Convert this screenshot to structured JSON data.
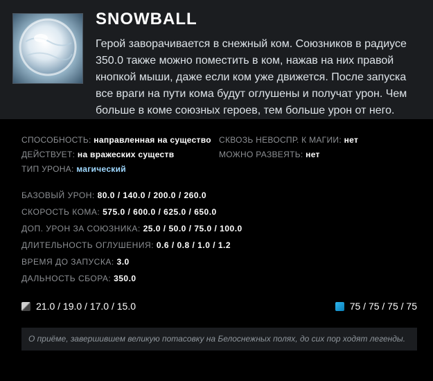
{
  "ability": {
    "icon": "snowball-icon",
    "name": "SNOWBALL",
    "description": "Герой заворачивается в снежный ком. Союзников в радиусе 350.0 также можно поместить в ком, нажав на них правой кнопкой мыши, даже если ком уже движется. После запуска все враги на пути кома будут оглушены и получат урон. Чем больше в коме союзных героев, тем больше урон от него."
  },
  "properties": {
    "ability_label": "СПОСОБНОСТЬ:",
    "ability_value": "направленная на существо",
    "pierce_label": "СКВОЗЬ НЕВОСПР. К МАГИИ:",
    "pierce_value": "нет",
    "affects_label": "ДЕЙСТВУЕТ:",
    "affects_value": "на вражеских существ",
    "dispel_label": "МОЖНО РАЗВЕЯТЬ:",
    "dispel_value": "нет",
    "damage_type_label": "ТИП УРОНА:",
    "damage_type_value": "магический"
  },
  "stats": [
    {
      "label": "БАЗОВЫЙ УРОН:",
      "value": "80.0 / 140.0 / 200.0 / 260.0"
    },
    {
      "label": "СКОРОСТЬ КОМА:",
      "value": "575.0 / 600.0 / 625.0 / 650.0"
    },
    {
      "label": "ДОП. УРОН ЗА СОЮЗНИКА:",
      "value": "25.0 / 50.0 / 75.0 / 100.0"
    },
    {
      "label": "ДЛИТЕЛЬНОСТЬ ОГЛУШЕНИЯ:",
      "value": "0.6 / 0.8 / 1.0 / 1.2"
    },
    {
      "label": "ВРЕМЯ ДО ЗАПУСКА:",
      "value": "3.0"
    },
    {
      "label": "ДАЛЬНОСТЬ СБОРА:",
      "value": "350.0"
    }
  ],
  "cooldown": {
    "icon": "cooldown-icon",
    "value": "21.0 / 19.0 / 17.0 / 15.0"
  },
  "mana": {
    "icon": "mana-icon",
    "value": "75 / 75 / 75 / 75",
    "color": "#1a9fd8"
  },
  "lore": "О приёме, завершившем великую потасовку на Белоснежных полях, до сих пор ходят легенды.",
  "colors": {
    "header_bg": "#1b1d20",
    "label": "#8c8f93",
    "magic": "#9fd8ff"
  }
}
